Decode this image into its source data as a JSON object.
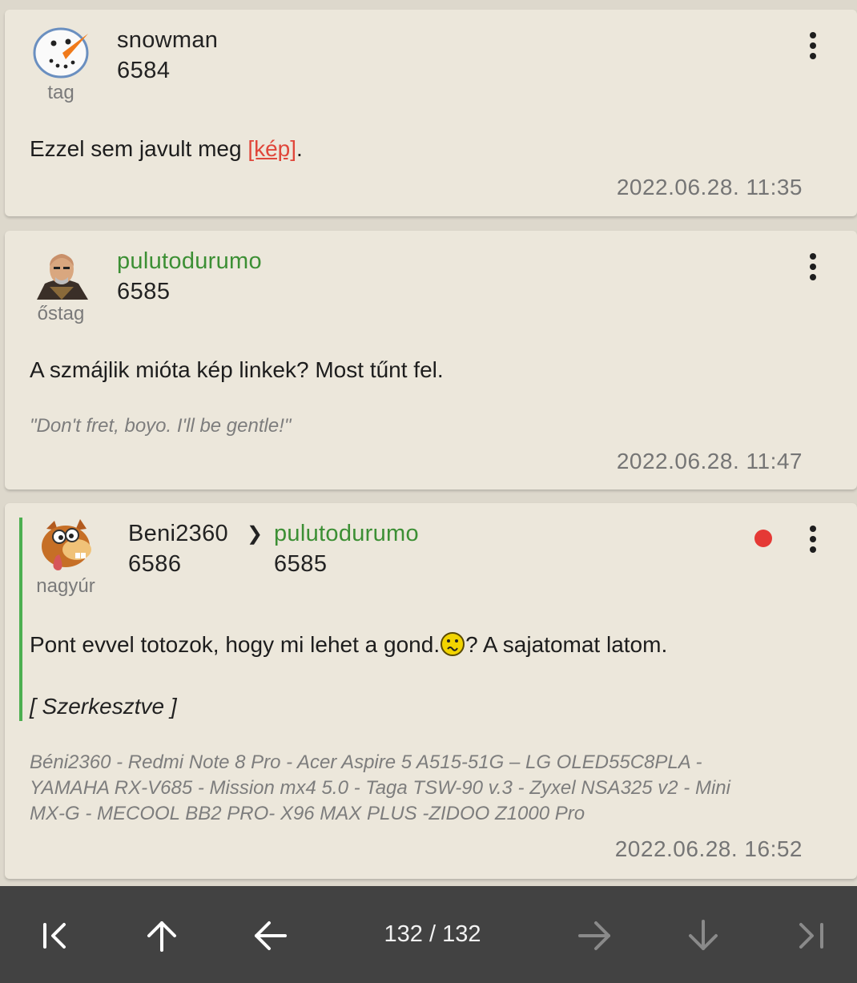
{
  "posts": [
    {
      "username": "snowman",
      "user_number": "6584",
      "rank": "tag",
      "avatar_icon": "snowman-avatar",
      "body_text": "Ezzel sem javult meg ",
      "body_link": "[kép]",
      "body_after": ".",
      "date": "2022.06.28. 11:35"
    },
    {
      "username": "pulutodurumo",
      "user_number": "6585",
      "rank": "őstag",
      "avatar_icon": "bald-man-avatar",
      "body_text": "A szmájlik mióta kép linkek? Most tűnt fel.",
      "signature": "\"Don't fret, boyo. I'll be gentle!\"",
      "date": "2022.06.28. 11:47"
    },
    {
      "username": "Beni2360",
      "user_number": "6586",
      "rank": "nagyúr",
      "avatar_icon": "cartoon-animal-avatar",
      "reply_arrow": "❯",
      "reply_to_username": "pulutodurumo",
      "reply_to_number": "6585",
      "body_before": "Pont evvel totozok, hogy mi lehet a gond.",
      "body_after": "? A sajatomat latom.",
      "edited_text": "[ Szerkesztve ]",
      "signature_lines": [
        "Béni2360 - Redmi Note 8 Pro - Acer Aspire 5 A515-51G – LG OLED55C8PLA -",
        "YAMAHA RX-V685 - Mission mx4 5.0 - Taga TSW-90 v.3 - Zyxel NSA325 v2 - Mini",
        "MX-G - MECOOL BB2 PRO- X96 MAX PLUS -ZIDOO Z1000 Pro"
      ],
      "date": "2022.06.28. 16:52",
      "unread_color": "#e53935"
    }
  ],
  "colors": {
    "background": "#ddd8cc",
    "card": "#ece7db",
    "username_highlight": "#3c8f34",
    "link": "#e0463a",
    "navbar": "#424242"
  },
  "navbar": {
    "page_indicator": "132 / 132",
    "buttons": [
      "first-page-icon",
      "scroll-top-icon",
      "prev-page-icon",
      "next-page-icon",
      "scroll-bottom-icon",
      "last-page-icon"
    ]
  }
}
